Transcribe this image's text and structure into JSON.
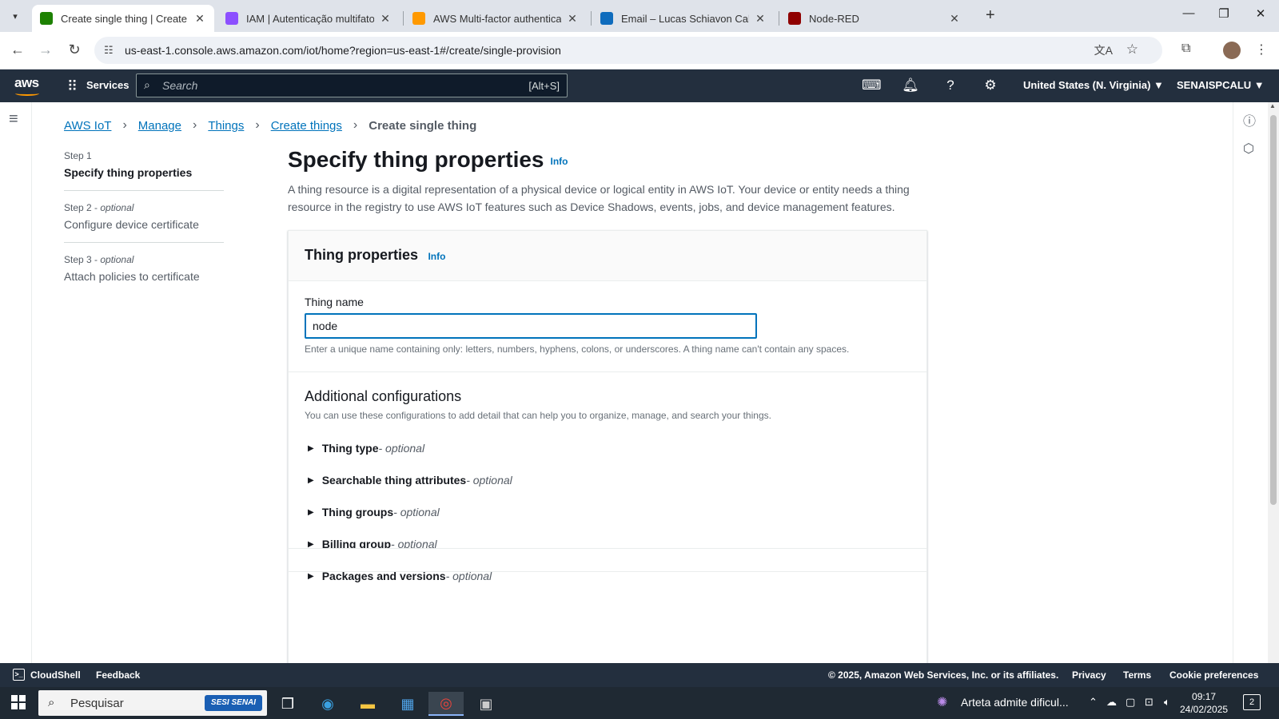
{
  "browser": {
    "tabs": [
      {
        "title": "Create single thing | Create thin",
        "active": true,
        "favicon_color": "#1d8102",
        "icon": "aws-iot-favicon"
      },
      {
        "title": "IAM | Autenticação multifator",
        "active": false,
        "favicon_color": "#8c4fff",
        "icon": "iam-favicon"
      },
      {
        "title": "AWS Multi-factor authenticatio",
        "active": false,
        "favicon_color": "#ff9900",
        "icon": "aws-docs-favicon"
      },
      {
        "title": "Email – Lucas Schiavon Calu – C",
        "active": false,
        "favicon_color": "#0f6cbd",
        "icon": "outlook-favicon"
      },
      {
        "title": "Node-RED",
        "active": false,
        "favicon_color": "#8f0000",
        "icon": "node-red-favicon"
      }
    ],
    "url": "us-east-1.console.aws.amazon.com/iot/home?region=us-east-1#/create/single-provision"
  },
  "aws_nav": {
    "logo": "aws",
    "services_label": "Services",
    "search_placeholder": "Search",
    "search_shortcut": "[Alt+S]",
    "region": "United States (N. Virginia) ▼",
    "account": "SENAISPCALU ▼"
  },
  "breadcrumb": {
    "items": [
      "AWS IoT",
      "Manage",
      "Things",
      "Create things"
    ],
    "current": "Create single thing"
  },
  "steps": [
    {
      "num": "Step 1",
      "optional": "",
      "label": "Specify thing properties",
      "active": true
    },
    {
      "num": "Step 2",
      "optional": "optional",
      "label": "Configure device certificate",
      "active": false
    },
    {
      "num": "Step 3",
      "optional": "optional",
      "label": "Attach policies to certificate",
      "active": false
    }
  ],
  "main": {
    "title": "Specify thing properties",
    "info": "Info",
    "description": "A thing resource is a digital representation of a physical device or logical entity in AWS IoT. Your device or entity needs a thing resource in the registry to use AWS IoT features such as Device Shadows, events, jobs, and device management features."
  },
  "thing_properties": {
    "heading": "Thing properties",
    "info": "Info",
    "name_label": "Thing name",
    "name_value": "node",
    "name_hint": "Enter a unique name containing only: letters, numbers, hyphens, colons, or underscores. A thing name can't contain any spaces."
  },
  "additional": {
    "heading": "Additional configurations",
    "subtext": "You can use these configurations to add detail that can help you to organize, manage, and search your things.",
    "sections": [
      {
        "name": "Thing type",
        "optional": " - optional"
      },
      {
        "name": "Searchable thing attributes",
        "optional": " - optional"
      },
      {
        "name": "Thing groups",
        "optional": " - optional"
      },
      {
        "name": "Billing group",
        "optional": " - optional"
      },
      {
        "name": "Packages and versions",
        "optional": " - optional"
      }
    ]
  },
  "footer": {
    "cloudshell": "CloudShell",
    "feedback": "Feedback",
    "copyright": "© 2025, Amazon Web Services, Inc. or its affiliates.",
    "privacy": "Privacy",
    "terms": "Terms",
    "cookies": "Cookie preferences"
  },
  "taskbar": {
    "search_text": "Pesquisar",
    "badge": "SESI SENAI",
    "news": "Arteta admite dificul...",
    "time": "09:17",
    "date": "24/02/2025",
    "notif_count": "2"
  }
}
